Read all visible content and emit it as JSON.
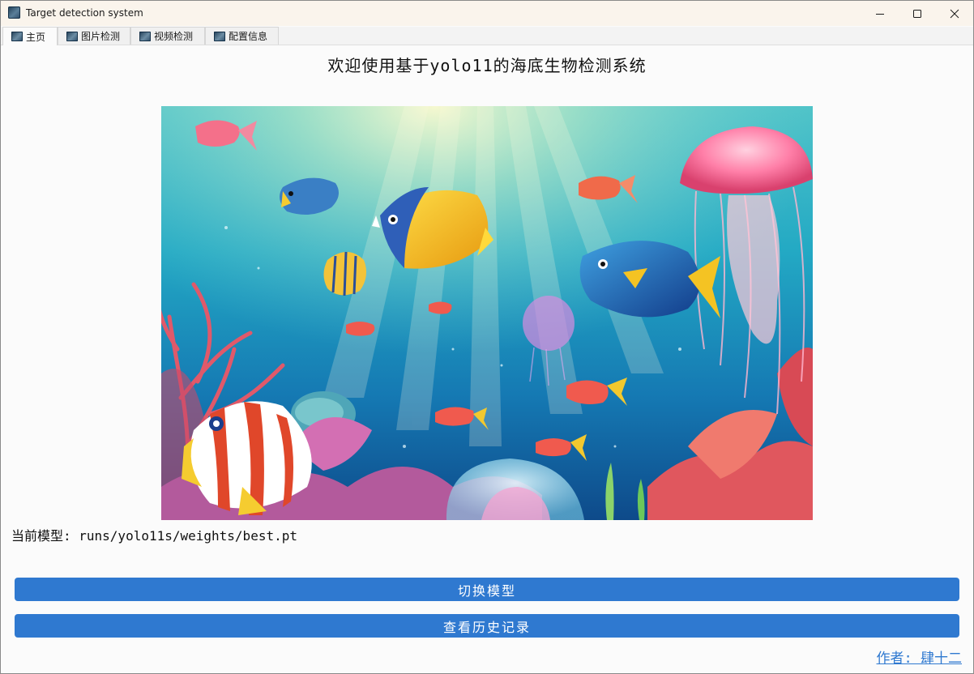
{
  "window": {
    "title": "Target detection system"
  },
  "tabs": [
    {
      "label": "主页",
      "icon": "app-thumbnail-icon",
      "active": true
    },
    {
      "label": "图片检测",
      "icon": "app-thumbnail-icon",
      "active": false
    },
    {
      "label": "视频检测",
      "icon": "app-thumbnail-icon",
      "active": false
    },
    {
      "label": "配置信息",
      "icon": "app-thumbnail-icon",
      "active": false
    }
  ],
  "home": {
    "heading": "欢迎使用基于yolo11的海底生物检测系统",
    "model_line": "当前模型: runs/yolo11s/weights/best.pt",
    "switch_model_label": "切换模型",
    "history_label": "查看历史记录",
    "author_link": "作者: 肆十二"
  },
  "colors": {
    "accent": "#2f79d0",
    "titlebar": "#faf4ec",
    "background": "#fbfbfb"
  }
}
